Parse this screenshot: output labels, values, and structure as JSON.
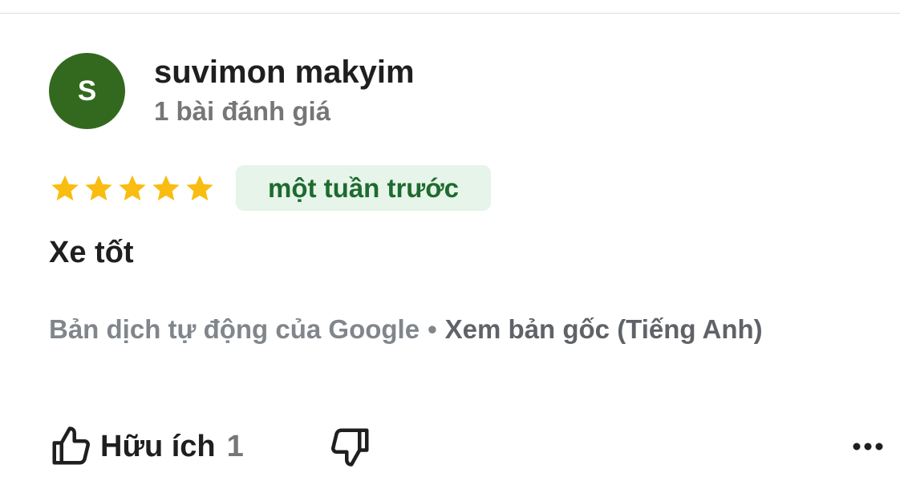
{
  "author": {
    "initial": "S",
    "name": "suvimon makyim",
    "review_count": "1 bài đánh giá",
    "avatar_color": "#33691e"
  },
  "review": {
    "rating": 5,
    "max_rating": 5,
    "star_color": "#f9bd11",
    "time": "một tuần trước",
    "text": "Xe tốt",
    "translation_note": "Bản dịch tự động của Google",
    "separator": "•",
    "see_original": "Xem bản gốc (Tiếng Anh)"
  },
  "actions": {
    "helpful_label": "Hữu ích",
    "helpful_count": "1",
    "helpful_icon": "thumbs-up-icon",
    "dislike_icon": "thumbs-down-icon",
    "more_icon": "more-horizontal-icon"
  }
}
